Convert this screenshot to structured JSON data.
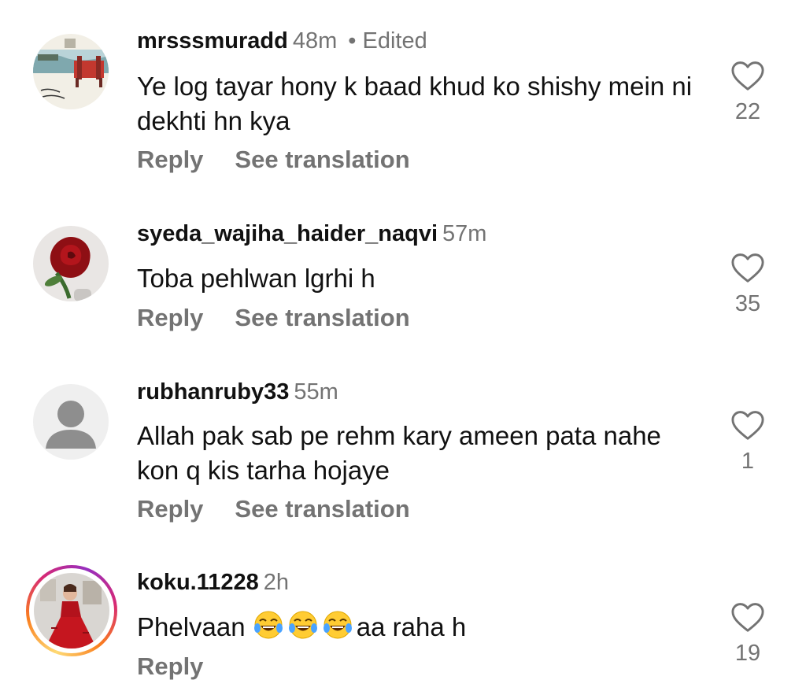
{
  "comments": [
    {
      "username": "mrsssmuradd",
      "time": "48m",
      "separator": "•",
      "edited": "Edited",
      "text": "Ye log tayar hony k baad khud ko shishy mein ni dekhti hn kya",
      "reply": "Reply",
      "translate": "See translation",
      "likes": "22",
      "avatar": "drawing-bench-avatar"
    },
    {
      "username": "syeda_wajiha_haider_naqvi",
      "time": "57m",
      "text": "Toba pehlwan lgrhi h",
      "reply": "Reply",
      "translate": "See translation",
      "likes": "35",
      "avatar": "rose-avatar"
    },
    {
      "username": "rubhanruby33",
      "time": "55m",
      "text": "Allah pak sab pe rehm kary ameen pata nahe kon q kis tarha hojaye",
      "reply": "Reply",
      "translate": "See translation",
      "likes": "1",
      "avatar": "default-user-avatar"
    },
    {
      "username": "koku.11228",
      "time": "2h",
      "text_before": "Phelvaan ",
      "emojis": [
        "laughing-tears-emoji",
        "laughing-tears-emoji",
        "laughing-tears-emoji"
      ],
      "text_after": "aa raha h",
      "reply": "Reply",
      "likes": "19",
      "avatar": "red-dress-avatar",
      "story_ring": true
    }
  ],
  "colors": {
    "text": "#111111",
    "secondary": "#737373",
    "avatar_placeholder_bg": "#dbdbdb",
    "avatar_placeholder_fg": "#8e8e8e"
  }
}
